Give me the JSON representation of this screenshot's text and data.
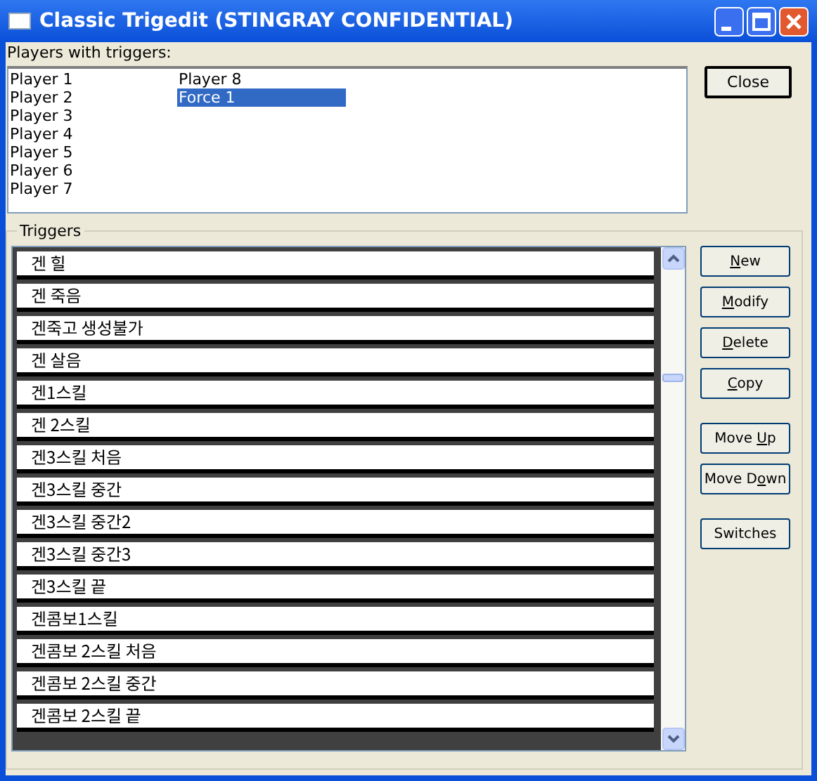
{
  "window": {
    "title": "Classic Trigedit (STINGRAY CONFIDENTIAL)"
  },
  "players_label": "Players with triggers:",
  "players": [
    {
      "label": "Player 1",
      "selected": false
    },
    {
      "label": "Player 2",
      "selected": false
    },
    {
      "label": "Player 3",
      "selected": false
    },
    {
      "label": "Player 4",
      "selected": false
    },
    {
      "label": "Player 5",
      "selected": false
    },
    {
      "label": "Player 6",
      "selected": false
    },
    {
      "label": "Player 7",
      "selected": false
    },
    {
      "label": "Player 8",
      "selected": false
    },
    {
      "label": "Force 1",
      "selected": true
    }
  ],
  "close_button": "Close",
  "triggers_group": "Triggers",
  "triggers": [
    "겐 힐",
    "겐 죽음",
    "겐죽고 생성불가",
    "겐 살음",
    "겐1스킬",
    "겐 2스킬",
    "겐3스킬 처음",
    "겐3스킬 중간",
    "겐3스킬 중간2",
    "겐3스킬 중간3",
    "겐3스킬 끝",
    "겐콤보1스킬",
    "겐콤보 2스킬 처음",
    "겐콤보 2스킬 중간",
    "겐콤보 2스킬 끝"
  ],
  "buttons": [
    {
      "accel": "N",
      "after": "ew",
      "kind": "first"
    },
    {
      "accel": "M",
      "after": "odify",
      "kind": "normal"
    },
    {
      "accel": "D",
      "after": "elete",
      "kind": "normal"
    },
    {
      "accel": "C",
      "after": "opy",
      "kind": "normal"
    },
    {
      "before": "Move ",
      "accel": "U",
      "after": "p",
      "kind": "gap"
    },
    {
      "before": "Move D",
      "accel": "o",
      "after": "wn",
      "kind": "normal"
    },
    {
      "before": "Switches",
      "kind": "gap"
    }
  ]
}
